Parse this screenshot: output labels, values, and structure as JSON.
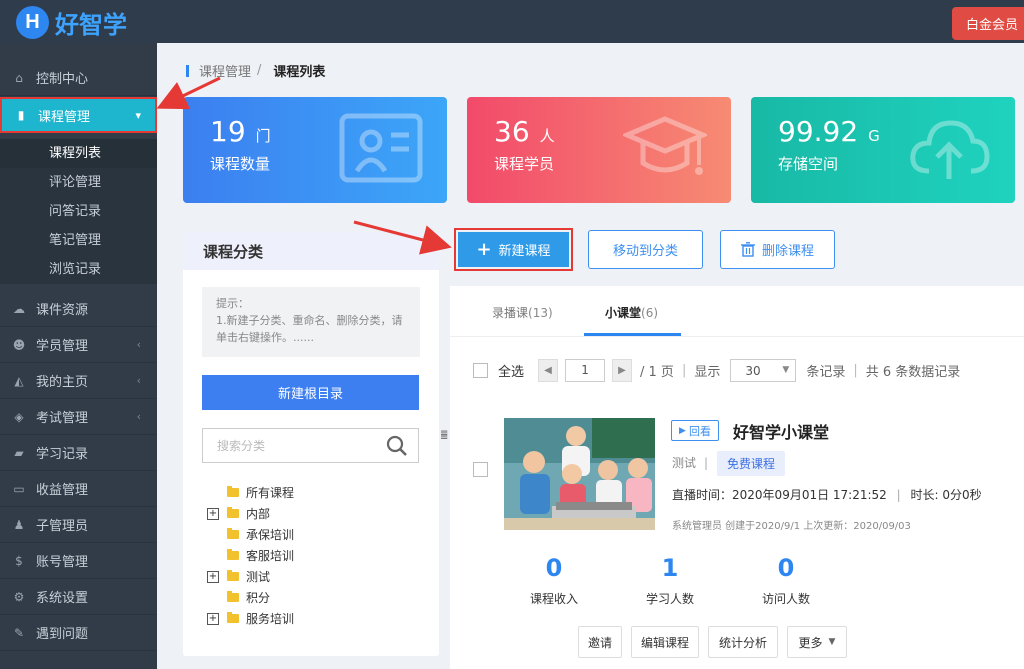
{
  "header": {
    "logo_mark": "H",
    "logo_text": "好智学",
    "vip_badge": "白金会员"
  },
  "sidebar": {
    "items": [
      {
        "label": "控制中心",
        "icon": "home-icon"
      },
      {
        "label": "课程管理",
        "icon": "book-icon",
        "active": true
      },
      {
        "label": "课件资源",
        "icon": "cloud-icon"
      },
      {
        "label": "学员管理",
        "icon": "users-icon"
      },
      {
        "label": "我的主页",
        "icon": "graduation-cap-icon"
      },
      {
        "label": "考试管理",
        "icon": "tags-icon"
      },
      {
        "label": "学习记录",
        "icon": "record-icon"
      },
      {
        "label": "收益管理",
        "icon": "card-icon"
      },
      {
        "label": "子管理员",
        "icon": "user-lock-icon"
      },
      {
        "label": "账号管理",
        "icon": "dollar-icon"
      },
      {
        "label": "系统设置",
        "icon": "gear-icon"
      },
      {
        "label": "遇到问题",
        "icon": "wrench-icon"
      }
    ],
    "sub_items": [
      "课程列表",
      "评论管理",
      "问答记录",
      "笔记管理",
      "浏览记录"
    ]
  },
  "breadcrumb": {
    "parent": "课程管理",
    "separator": "/",
    "current": "课程列表"
  },
  "stats": [
    {
      "value": "19",
      "unit": "门",
      "label": "课程数量"
    },
    {
      "value": "36",
      "unit": "人",
      "label": "课程学员"
    },
    {
      "value": "99.92",
      "unit": "G",
      "label": "存储空间"
    }
  ],
  "category": {
    "title": "课程分类",
    "tip_title": "提示：",
    "tip_body": "1.新建子分类、重命名、删除分类，请单击右键操作。......",
    "new_root": "新建根目录",
    "search_placeholder": "搜索分类",
    "tree": [
      {
        "label": "所有课程",
        "expandable": false
      },
      {
        "label": "内部",
        "expandable": true
      },
      {
        "label": "承保培训",
        "expandable": false
      },
      {
        "label": "客服培训",
        "expandable": false
      },
      {
        "label": "测试",
        "expandable": true
      },
      {
        "label": "积分",
        "expandable": false
      },
      {
        "label": "服务培训",
        "expandable": true
      }
    ]
  },
  "actions": {
    "new_course": "新建课程",
    "move": "移动到分类",
    "delete": "删除课程"
  },
  "tabs": [
    {
      "label": "录播课",
      "count": "(13)"
    },
    {
      "label": "小课堂",
      "count": "(6)",
      "active": true
    }
  ],
  "toolbar": {
    "select_all": "全选",
    "page": "1",
    "page_total": "/ 1 页",
    "sep": "|",
    "show": "显示",
    "page_size": "30",
    "records": "条记录",
    "total": "共 6 条数据记录"
  },
  "course": {
    "replay": "回看",
    "title": "好智学小课堂",
    "category": "测试",
    "tag": "免费课程",
    "live_time_label": "直播时间：",
    "live_time": "2020年09月01日 17:21:52",
    "duration_label": "时长: ",
    "duration": "0分0秒",
    "meta": "系统管理员 创建于2020/9/1 上次更新：2020/09/03",
    "metrics": [
      {
        "value": "0",
        "label": "课程收入"
      },
      {
        "value": "1",
        "label": "学习人数"
      },
      {
        "value": "0",
        "label": "访问人数"
      }
    ],
    "buttons": [
      "邀请",
      "编辑课程",
      "统计分析",
      "更多"
    ]
  },
  "colors": {
    "primary": "#2e86f0",
    "sidebar": "#313c48",
    "active_item": "#1eb6cf",
    "annotation": "#e53935"
  }
}
